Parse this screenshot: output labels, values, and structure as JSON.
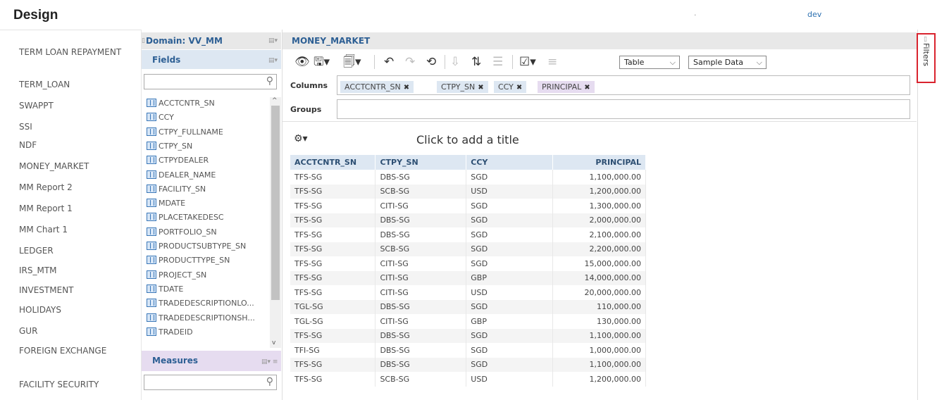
{
  "header": {
    "title": "Design",
    "dot": ".",
    "user": "dev"
  },
  "reports": [
    "TERM LOAN REPAYMENT",
    "TERM_LOAN",
    "SWAPPT",
    "SSI",
    "NDF",
    "MONEY_MARKET",
    "MM Report 2",
    "MM Report 1",
    "MM Chart 1",
    "LEDGER",
    "IRS_MTM",
    "INVESTMENT",
    "HOLIDAYS",
    "GUR",
    "FOREIGN EXCHANGE",
    "FACILITY SECURITY"
  ],
  "fields_panel": {
    "domain_label": "Domain: VV_MM",
    "fields_title": "Fields",
    "measures_title": "Measures",
    "field_items": [
      "ACCTCNTR_SN",
      "CCY",
      "CTPY_FULLNAME",
      "CTPY_SN",
      "CTPYDEALER",
      "DEALER_NAME",
      "FACILITY_SN",
      "MDATE",
      "PLACETAKEDESC",
      "PORTFOLIO_SN",
      "PRODUCTSUBTYPE_SN",
      "PRODUCTTYPE_SN",
      "PROJECT_SN",
      "TDATE",
      "TRADEDESCRIPTIONLO...",
      "TRADEDESCRIPTIONSH...",
      "TRADEID"
    ]
  },
  "main": {
    "report_name": "MONEY_MARKET",
    "view_select": "Table",
    "data_select": "Sample Data",
    "columns_label": "Columns",
    "groups_label": "Groups",
    "column_chips": [
      "ACCTCNTR_SN",
      "CTPY_SN",
      "CCY",
      "PRINCIPAL"
    ],
    "add_title": "Click to add a title",
    "table": {
      "headers": [
        "ACCTCNTR_SN",
        "CTPY_SN",
        "CCY",
        "PRINCIPAL"
      ],
      "rows": [
        [
          "TFS-SG",
          "DBS-SG",
          "SGD",
          "1,100,000.00"
        ],
        [
          "TFS-SG",
          "SCB-SG",
          "USD",
          "1,200,000.00"
        ],
        [
          "TFS-SG",
          "CITI-SG",
          "SGD",
          "1,300,000.00"
        ],
        [
          "TFS-SG",
          "DBS-SG",
          "SGD",
          "2,000,000.00"
        ],
        [
          "TFS-SG",
          "DBS-SG",
          "SGD",
          "2,100,000.00"
        ],
        [
          "TFS-SG",
          "SCB-SG",
          "SGD",
          "2,200,000.00"
        ],
        [
          "TFS-SG",
          "CITI-SG",
          "SGD",
          "15,000,000.00"
        ],
        [
          "TFS-SG",
          "CITI-SG",
          "GBP",
          "14,000,000.00"
        ],
        [
          "TFS-SG",
          "CITI-SG",
          "USD",
          "20,000,000.00"
        ],
        [
          "TGL-SG",
          "DBS-SG",
          "SGD",
          "110,000.00"
        ],
        [
          "TGL-SG",
          "CITI-SG",
          "GBP",
          "130,000.00"
        ],
        [
          "TFS-SG",
          "DBS-SG",
          "SGD",
          "1,100,000.00"
        ],
        [
          "TFI-SG",
          "DBS-SG",
          "SGD",
          "1,000,000.00"
        ],
        [
          "TFS-SG",
          "DBS-SG",
          "SGD",
          "1,100,000.00"
        ],
        [
          "TFS-SG",
          "SCB-SG",
          "USD",
          "1,200,000.00"
        ]
      ]
    }
  },
  "filters": {
    "label": "Filters"
  },
  "colors": {
    "accent": "#2d5f94",
    "fields_bg": "#dde7f2",
    "measures_bg": "#e6dcf0",
    "highlight": "#d9232e"
  }
}
